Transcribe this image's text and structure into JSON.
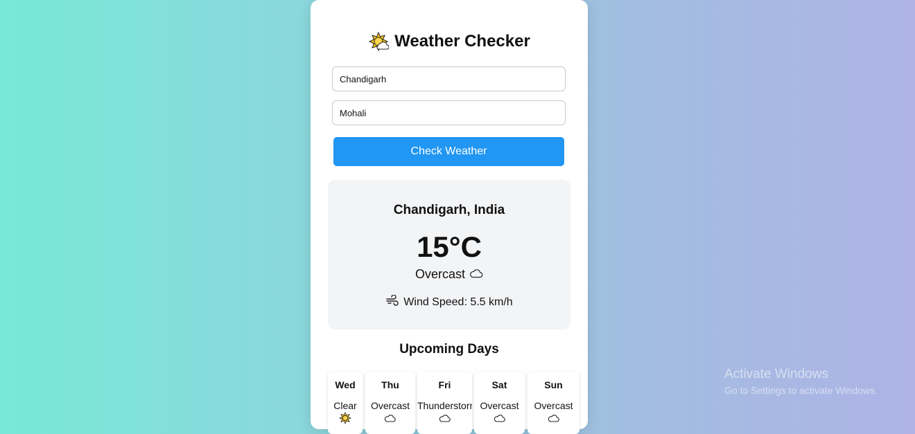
{
  "app": {
    "title": "Weather Checker",
    "title_icon": "sun-behind-cloud-icon"
  },
  "form": {
    "city_value": "Chandigarh",
    "area_value": "Mohali",
    "submit_label": "Check Weather",
    "accent_color": "#2196f3"
  },
  "current": {
    "location": "Chandigarh, India",
    "temperature": "15°C",
    "condition": "Overcast",
    "condition_icon": "cloud-icon",
    "wind_text": "Wind Speed: 5.5 km/h",
    "wind_icon": "wind-icon"
  },
  "forecast": {
    "heading": "Upcoming Days",
    "days": [
      {
        "name": "Wed",
        "condition": "Clear",
        "icon": "sun-icon"
      },
      {
        "name": "Thu",
        "condition": "Overcast",
        "icon": "cloud-icon"
      },
      {
        "name": "Fri",
        "condition": "Thunderstorm",
        "icon": "cloud-icon"
      },
      {
        "name": "Sat",
        "condition": "Overcast",
        "icon": "cloud-icon"
      },
      {
        "name": "Sun",
        "condition": "Overcast",
        "icon": "cloud-icon"
      }
    ]
  },
  "os_watermark": {
    "title": "Activate Windows",
    "subtitle": "Go to Settings to activate Windows."
  }
}
